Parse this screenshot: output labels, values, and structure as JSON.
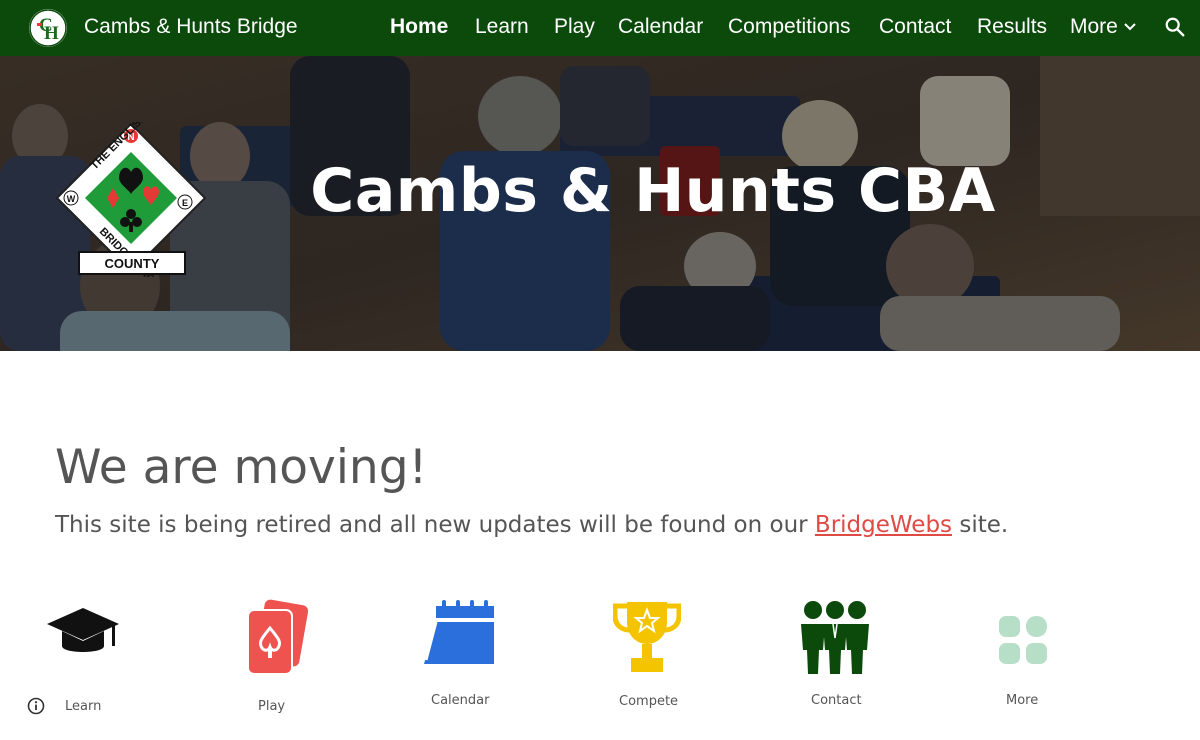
{
  "header": {
    "site_title": "Cambs & Hunts Bridge",
    "logo_text": "CH"
  },
  "nav": {
    "items": [
      {
        "label": "Home",
        "active": true
      },
      {
        "label": "Learn"
      },
      {
        "label": "Play"
      },
      {
        "label": "Calendar"
      },
      {
        "label": "Competitions"
      },
      {
        "label": "Contact"
      },
      {
        "label": "Results"
      },
      {
        "label": "More"
      }
    ],
    "search_icon": "search-icon"
  },
  "hero": {
    "title": "Cambs & Hunts CBA",
    "logo": {
      "compass_n": "N",
      "compass_e": "E",
      "compass_w": "W",
      "arc_top": "THE ENGLISH",
      "arc_bottom": "BRIDGE UNION",
      "badge": "COUNTY"
    }
  },
  "main": {
    "heading": "We are moving!",
    "text_before": "This site is being retired and all new updates will be found on our ",
    "link_text": "BridgeWebs",
    "text_after": " site."
  },
  "tiles": [
    {
      "label": "Learn",
      "icon": "graduation-cap-icon",
      "color": "#111111"
    },
    {
      "label": "Play",
      "icon": "playing-cards-icon",
      "color": "#ef5350"
    },
    {
      "label": "Calendar",
      "icon": "calendar-icon",
      "color": "#2a6fdb"
    },
    {
      "label": "Compete",
      "icon": "trophy-icon",
      "color": "#f5c400"
    },
    {
      "label": "Contact",
      "icon": "people-icon",
      "color": "#0b4a0b"
    },
    {
      "label": "More",
      "icon": "grid-icon",
      "color": "#b7dfc8"
    }
  ],
  "colors": {
    "nav_bg": "#0b4a0b",
    "link": "#e04a45",
    "text": "#555555"
  }
}
